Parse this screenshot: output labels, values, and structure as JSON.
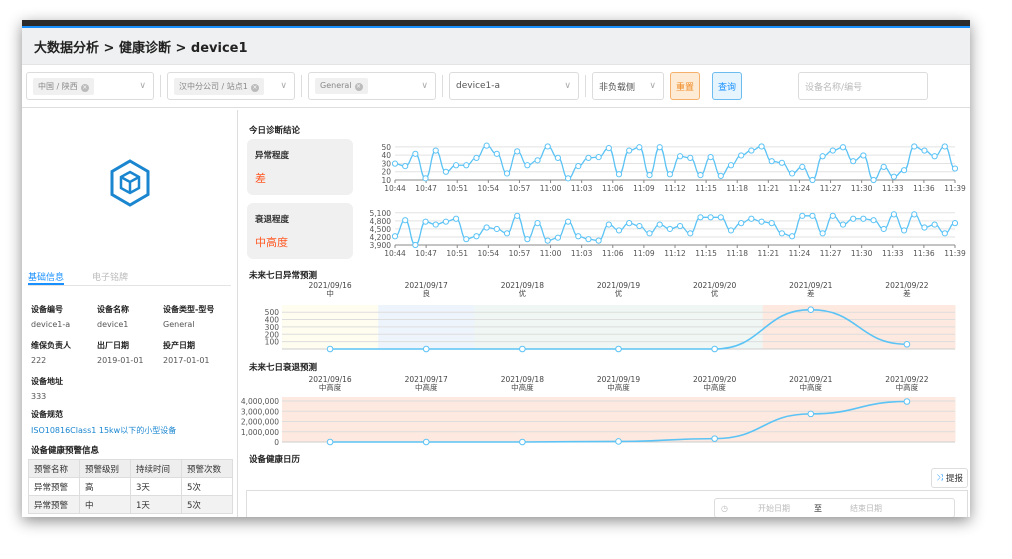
{
  "header": {
    "breadcrumb": "大数据分析 > 健康诊断 > device1"
  },
  "filters": {
    "region": "中国 / 陕西",
    "site": "汉中分公司 / 站点1",
    "type": "General",
    "device": "device1-a",
    "side": "非负载侧",
    "reset": "重置",
    "query": "查询",
    "search_placeholder": "设备名称/编号"
  },
  "left": {
    "tabs": [
      "基础信息",
      "电子铭牌"
    ],
    "fields": [
      {
        "label": "设备编号",
        "value": "device1-a"
      },
      {
        "label": "设备名称",
        "value": "device1"
      },
      {
        "label": "设备类型-型号",
        "value": "General"
      },
      {
        "label": "维保负责人",
        "value": "222"
      },
      {
        "label": "出厂日期",
        "value": "2019-01-01"
      },
      {
        "label": "投产日期",
        "value": "2017-01-01"
      },
      {
        "label": "设备地址",
        "value": "333"
      },
      {
        "label": "设备规范",
        "value": "ISO10816Class1 15kw以下的小型设备"
      }
    ],
    "warn_title": "设备健康预警信息",
    "warn_headers": [
      "预警名称",
      "预警级别",
      "持续时间",
      "预警次数"
    ],
    "warn_rows": [
      [
        "异常预警",
        "高",
        "3天",
        "5次"
      ],
      [
        "异常预警",
        "中",
        "1天",
        "5次"
      ]
    ]
  },
  "main": {
    "today_title": "今日诊断结论",
    "cards": [
      {
        "label": "异常程度",
        "value": "差"
      },
      {
        "label": "衰退程度",
        "value": "中高度"
      }
    ],
    "forecast1_title": "未来七日异常预测",
    "forecast2_title": "未来七日衰退预测",
    "calendar_title": "设备健康日历",
    "report_button": "提报",
    "start_date": "开始日期",
    "to": "至",
    "end_date": "结束日期"
  },
  "colors": {
    "line": "#5bc3f5",
    "accent": "#1890ff",
    "warn": "#ff5722"
  },
  "chart_data": [
    {
      "type": "line",
      "name": "anomaly-today",
      "yticks": [
        10,
        20,
        30,
        40,
        50
      ],
      "ylim": [
        8,
        52
      ],
      "xticks": [
        "10:44",
        "10:47",
        "10:51",
        "10:54",
        "10:57",
        "11:00",
        "11:03",
        "11:06",
        "11:09",
        "11:12",
        "11:15",
        "11:18",
        "11:21",
        "11:24",
        "11:27",
        "11:30",
        "11:33",
        "11:36",
        "11:39"
      ],
      "values": [
        28,
        25,
        40,
        10,
        44,
        18,
        26,
        26,
        35,
        50,
        40,
        16,
        43,
        26,
        32,
        49,
        35,
        10,
        25,
        35,
        36,
        47,
        15,
        44,
        48,
        14,
        48,
        15,
        37,
        35,
        14,
        36,
        13,
        26,
        38,
        44,
        49,
        31,
        29,
        16,
        24,
        8,
        37,
        44,
        48,
        31,
        38,
        8,
        24,
        12,
        20,
        49,
        44,
        37,
        49,
        22
      ]
    },
    {
      "type": "line",
      "name": "degradation-today",
      "yticks": [
        "3,900",
        "4,200",
        "4,500",
        "4,800",
        "5,100"
      ],
      "ylim": [
        3900,
        5100
      ],
      "xticks": [
        "10:44",
        "10:47",
        "10:51",
        "10:54",
        "10:57",
        "11:00",
        "11:03",
        "11:06",
        "11:09",
        "11:12",
        "11:15",
        "11:18",
        "11:21",
        "11:24",
        "11:27",
        "11:30",
        "11:33",
        "11:36",
        "11:39"
      ],
      "values": [
        4200,
        4750,
        3900,
        4700,
        4600,
        4700,
        4800,
        4100,
        4200,
        4500,
        4450,
        4300,
        4900,
        4100,
        4650,
        4050,
        4150,
        4700,
        4200,
        4100,
        4050,
        4600,
        4400,
        4650,
        4550,
        4300,
        4600,
        4450,
        4550,
        4300,
        4850,
        4850,
        4850,
        4400,
        4650,
        4800,
        4700,
        4650,
        4300,
        4200,
        4900,
        4900,
        4300,
        4900,
        4600,
        4800,
        4800,
        4750,
        4450,
        4950,
        4400,
        4950,
        4500,
        4600,
        4300,
        4650
      ]
    },
    {
      "type": "line",
      "name": "anomaly-forecast",
      "categories": [
        "2021/09/16",
        "2021/09/17",
        "2021/09/18",
        "2021/09/19",
        "2021/09/20",
        "2021/09/21",
        "2021/09/22"
      ],
      "grades": [
        "中",
        "良",
        "优",
        "优",
        "优",
        "差",
        "差"
      ],
      "band_colors": [
        "#fffdf0",
        "#eef4fc",
        "#eff6f3",
        "#eff6f3",
        "#eff6f3",
        "#fde9df",
        "#fde9df"
      ],
      "values": [
        0,
        0,
        0,
        0,
        0,
        500,
        60
      ],
      "yticks": [
        "100",
        "200",
        "300",
        "400",
        "500"
      ],
      "ylim": [
        0,
        560
      ]
    },
    {
      "type": "line",
      "name": "degradation-forecast",
      "categories": [
        "2021/09/16",
        "2021/09/17",
        "2021/09/18",
        "2021/09/19",
        "2021/09/20",
        "2021/09/21",
        "2021/09/22"
      ],
      "grades": [
        "中高度",
        "中高度",
        "中高度",
        "中高度",
        "中高度",
        "中高度",
        "中高度"
      ],
      "values": [
        0,
        0,
        0,
        50000,
        300000,
        2500000,
        3600000
      ],
      "yticks": [
        "0",
        "1,000,000",
        "2,000,000",
        "3,000,000",
        "4,000,000"
      ],
      "ylim": [
        0,
        4000000
      ]
    }
  ]
}
